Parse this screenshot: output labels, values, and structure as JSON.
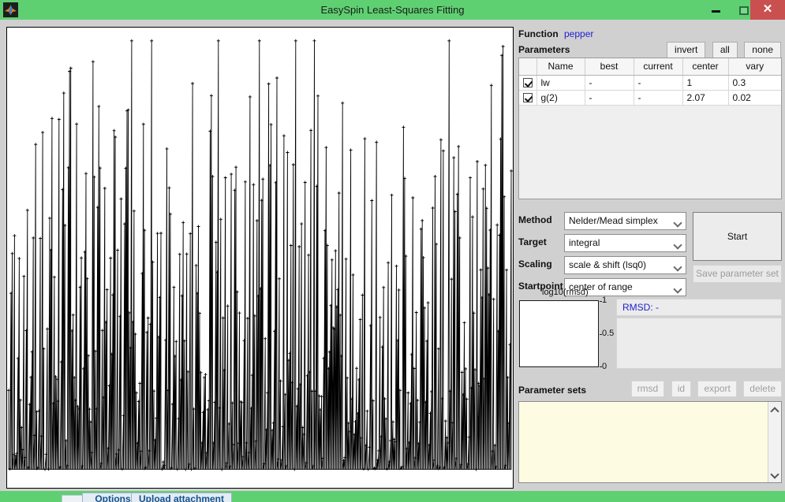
{
  "window": {
    "title": "EasySpin Least-Squares Fitting",
    "app_icon": "matlab-icon",
    "minimize_glyph": "minimize-icon",
    "maximize_glyph": "maximize-icon",
    "close_glyph": "✕",
    "titlebar_color": "#5fd072",
    "close_color": "#c9504f",
    "body_color": "#d0d0d0"
  },
  "function": {
    "label": "Function",
    "value": "pepper",
    "value_color": "#2222cc"
  },
  "parameters": {
    "label": "Parameters",
    "select_buttons": [
      "invert",
      "all",
      "none"
    ],
    "columns": [
      "",
      "Name",
      "best",
      "current",
      "center",
      "vary"
    ],
    "rows": [
      {
        "checked": true,
        "name": "lw",
        "best": "-",
        "current": "-",
        "center": "1",
        "vary": "0.3"
      },
      {
        "checked": true,
        "name": "g(2)",
        "best": "-",
        "current": "-",
        "center": "2.07",
        "vary": "0.02"
      }
    ]
  },
  "settings": {
    "rows": [
      {
        "label": "Method",
        "value": "Nelder/Mead simplex"
      },
      {
        "label": "Target",
        "value": "integral"
      },
      {
        "label": "Scaling",
        "value": "scale & shift (lsq0)"
      },
      {
        "label": "Startpoint",
        "value": "center of range"
      }
    ],
    "start_label": "Start",
    "save_label": "Save parameter set"
  },
  "rmsd": {
    "plot_title": "log10(rmsd)",
    "y_ticks": [
      "1",
      "0.5",
      "0"
    ],
    "readout": "RMSD: -",
    "readout_color": "#2222cc",
    "log_text": ""
  },
  "parameter_sets": {
    "label": "Parameter sets",
    "buttons": [
      "rmsd",
      "id",
      "export",
      "delete"
    ],
    "items": [],
    "scroll_up_icon": "chevron-up-icon",
    "scroll_down_icon": "chevron-down-icon"
  },
  "background_page": {
    "options_label": "Options",
    "upload_label": "Upload attachment"
  },
  "chart_data": {
    "type": "line",
    "title": "",
    "xlabel": "",
    "ylabel": "",
    "description": "Dense noisy spectrum trace with point markers, black on white",
    "n_points": 430,
    "seed": 20240517,
    "xlim": [
      0,
      641
    ],
    "ylim": [
      0,
      584
    ],
    "baseline_frac": 0.96,
    "grid": false,
    "legend": null,
    "marker": "plus",
    "color": "#000000"
  }
}
